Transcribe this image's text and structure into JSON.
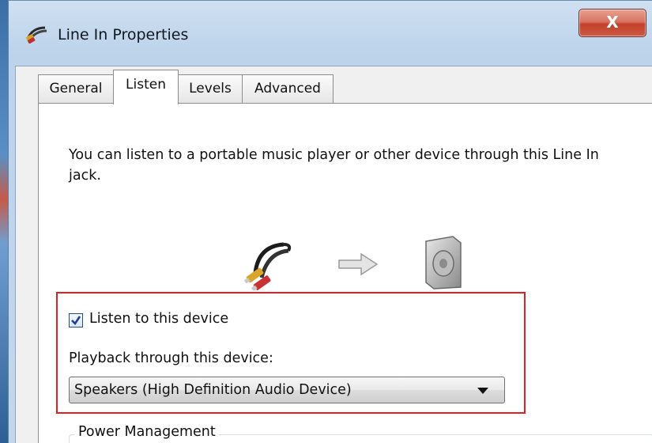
{
  "window": {
    "title": "Line In Properties",
    "close_label": "X"
  },
  "tabs": [
    {
      "label": "General",
      "active": false
    },
    {
      "label": "Listen",
      "active": true
    },
    {
      "label": "Levels",
      "active": false
    },
    {
      "label": "Advanced",
      "active": false
    }
  ],
  "listen": {
    "description": "You can listen to a portable music player or other device through this Line In jack.",
    "listen_checkbox": {
      "label": "Listen to this device",
      "checked": true
    },
    "playback_label": "Playback through this device:",
    "playback_device": "Speakers (High Definition Audio Device)",
    "power_group_label": "Power Management"
  },
  "icons": {
    "title": "audio-jack-icon",
    "source": "audio-jack-icon",
    "flow": "right-arrow-icon",
    "target": "speaker-icon"
  },
  "colors": {
    "highlight": "#e02020",
    "close_button": "#c2402b"
  }
}
